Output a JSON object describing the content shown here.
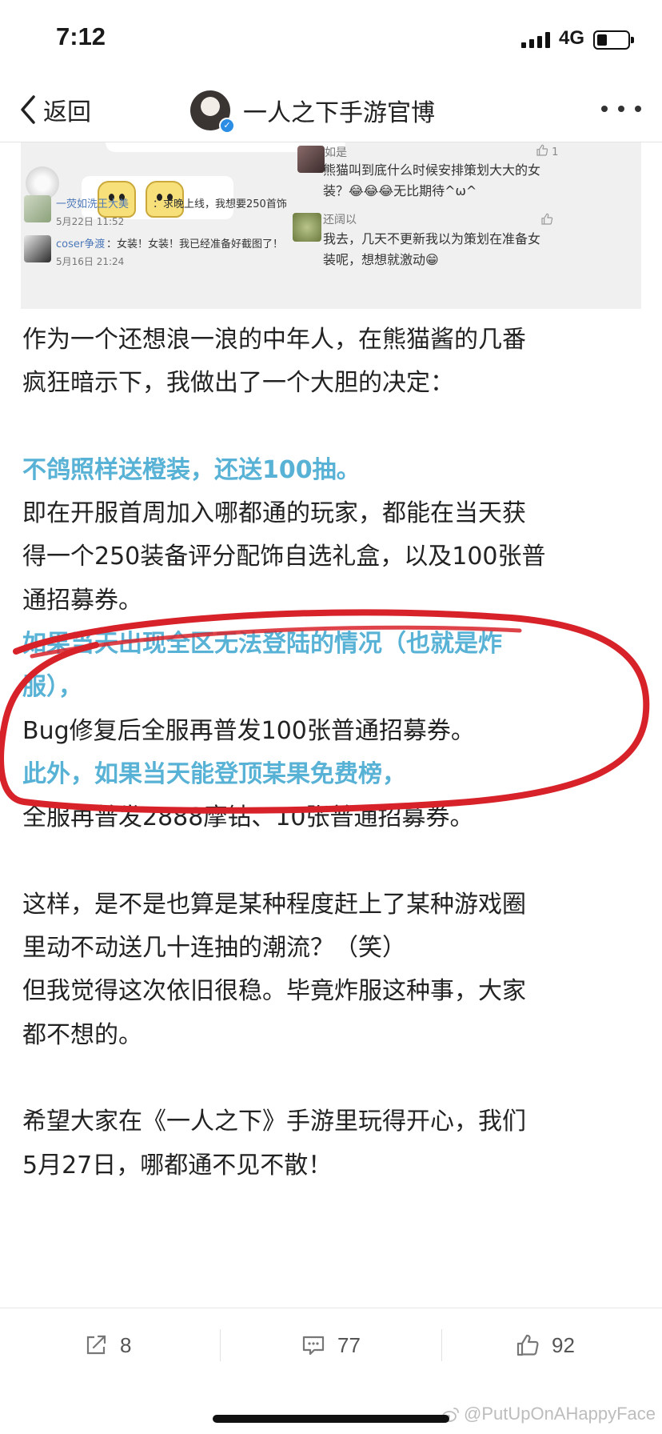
{
  "status_bar": {
    "time": "7:12",
    "network": "4G"
  },
  "nav": {
    "back_label": "返回",
    "title": "一人之下手游官博"
  },
  "embedded_screenshot": {
    "left_comments": [
      {
        "name": "一荧如洗王大美",
        "text": "：求晚上线，我想要250首饰",
        "date": "5月22日 11:52"
      },
      {
        "name": "coser争渡",
        "text": "：女装！女装！我已经准备好截图了！",
        "date": "5月16日 21:24"
      }
    ],
    "right_comments": [
      {
        "name": "如是",
        "like_count": "1",
        "text_line1": "熊猫叫到底什么时候安排策划大大的女",
        "text_line2": "装？😂😂😂无比期待^ω^"
      },
      {
        "name": "还阔以",
        "like_count": "",
        "text_line1": "我去，几天不更新我以为策划在准备女",
        "text_line2": "装呢，想想就激动😁"
      }
    ]
  },
  "post": {
    "lines": [
      " 作为一个还想浪一浪的中年人，在熊猫酱的几番",
      "疯狂暗示下，我做出了一个大胆的决定：",
      "",
      "不鸽照样送橙装，还送100抽。",
      "即在开服首周加入哪都通的玩家，都能在当天获",
      "得一个250装备评分配饰自选礼盒，以及100张普",
      "通招募券。",
      "如果当天出现全区无法登陆的情况（也就是炸",
      "服），",
      "Bug修复后全服再普发100张普通招募券。",
      "此外，如果当天能登顶某果免费榜，",
      "全服再普发2888摩钻、10张普通招募券。",
      "",
      "这样，是不是也算是某种程度赶上了某种游戏圈",
      "里动不动送几十连抽的潮流？（笑）",
      "但我觉得这次依旧很稳。毕竟炸服这种事，大家",
      "都不想的。",
      "",
      "希望大家在《一人之下》手游里玩得开心，我们",
      "5月27日，哪都通不见不散！"
    ],
    "highlight_color": "#58b2d6",
    "annotation_color": "#d8222a"
  },
  "actions": {
    "repost_count": "8",
    "comment_count": "77",
    "like_count": "92"
  },
  "watermark": "@PutUpOnAHappyFace"
}
